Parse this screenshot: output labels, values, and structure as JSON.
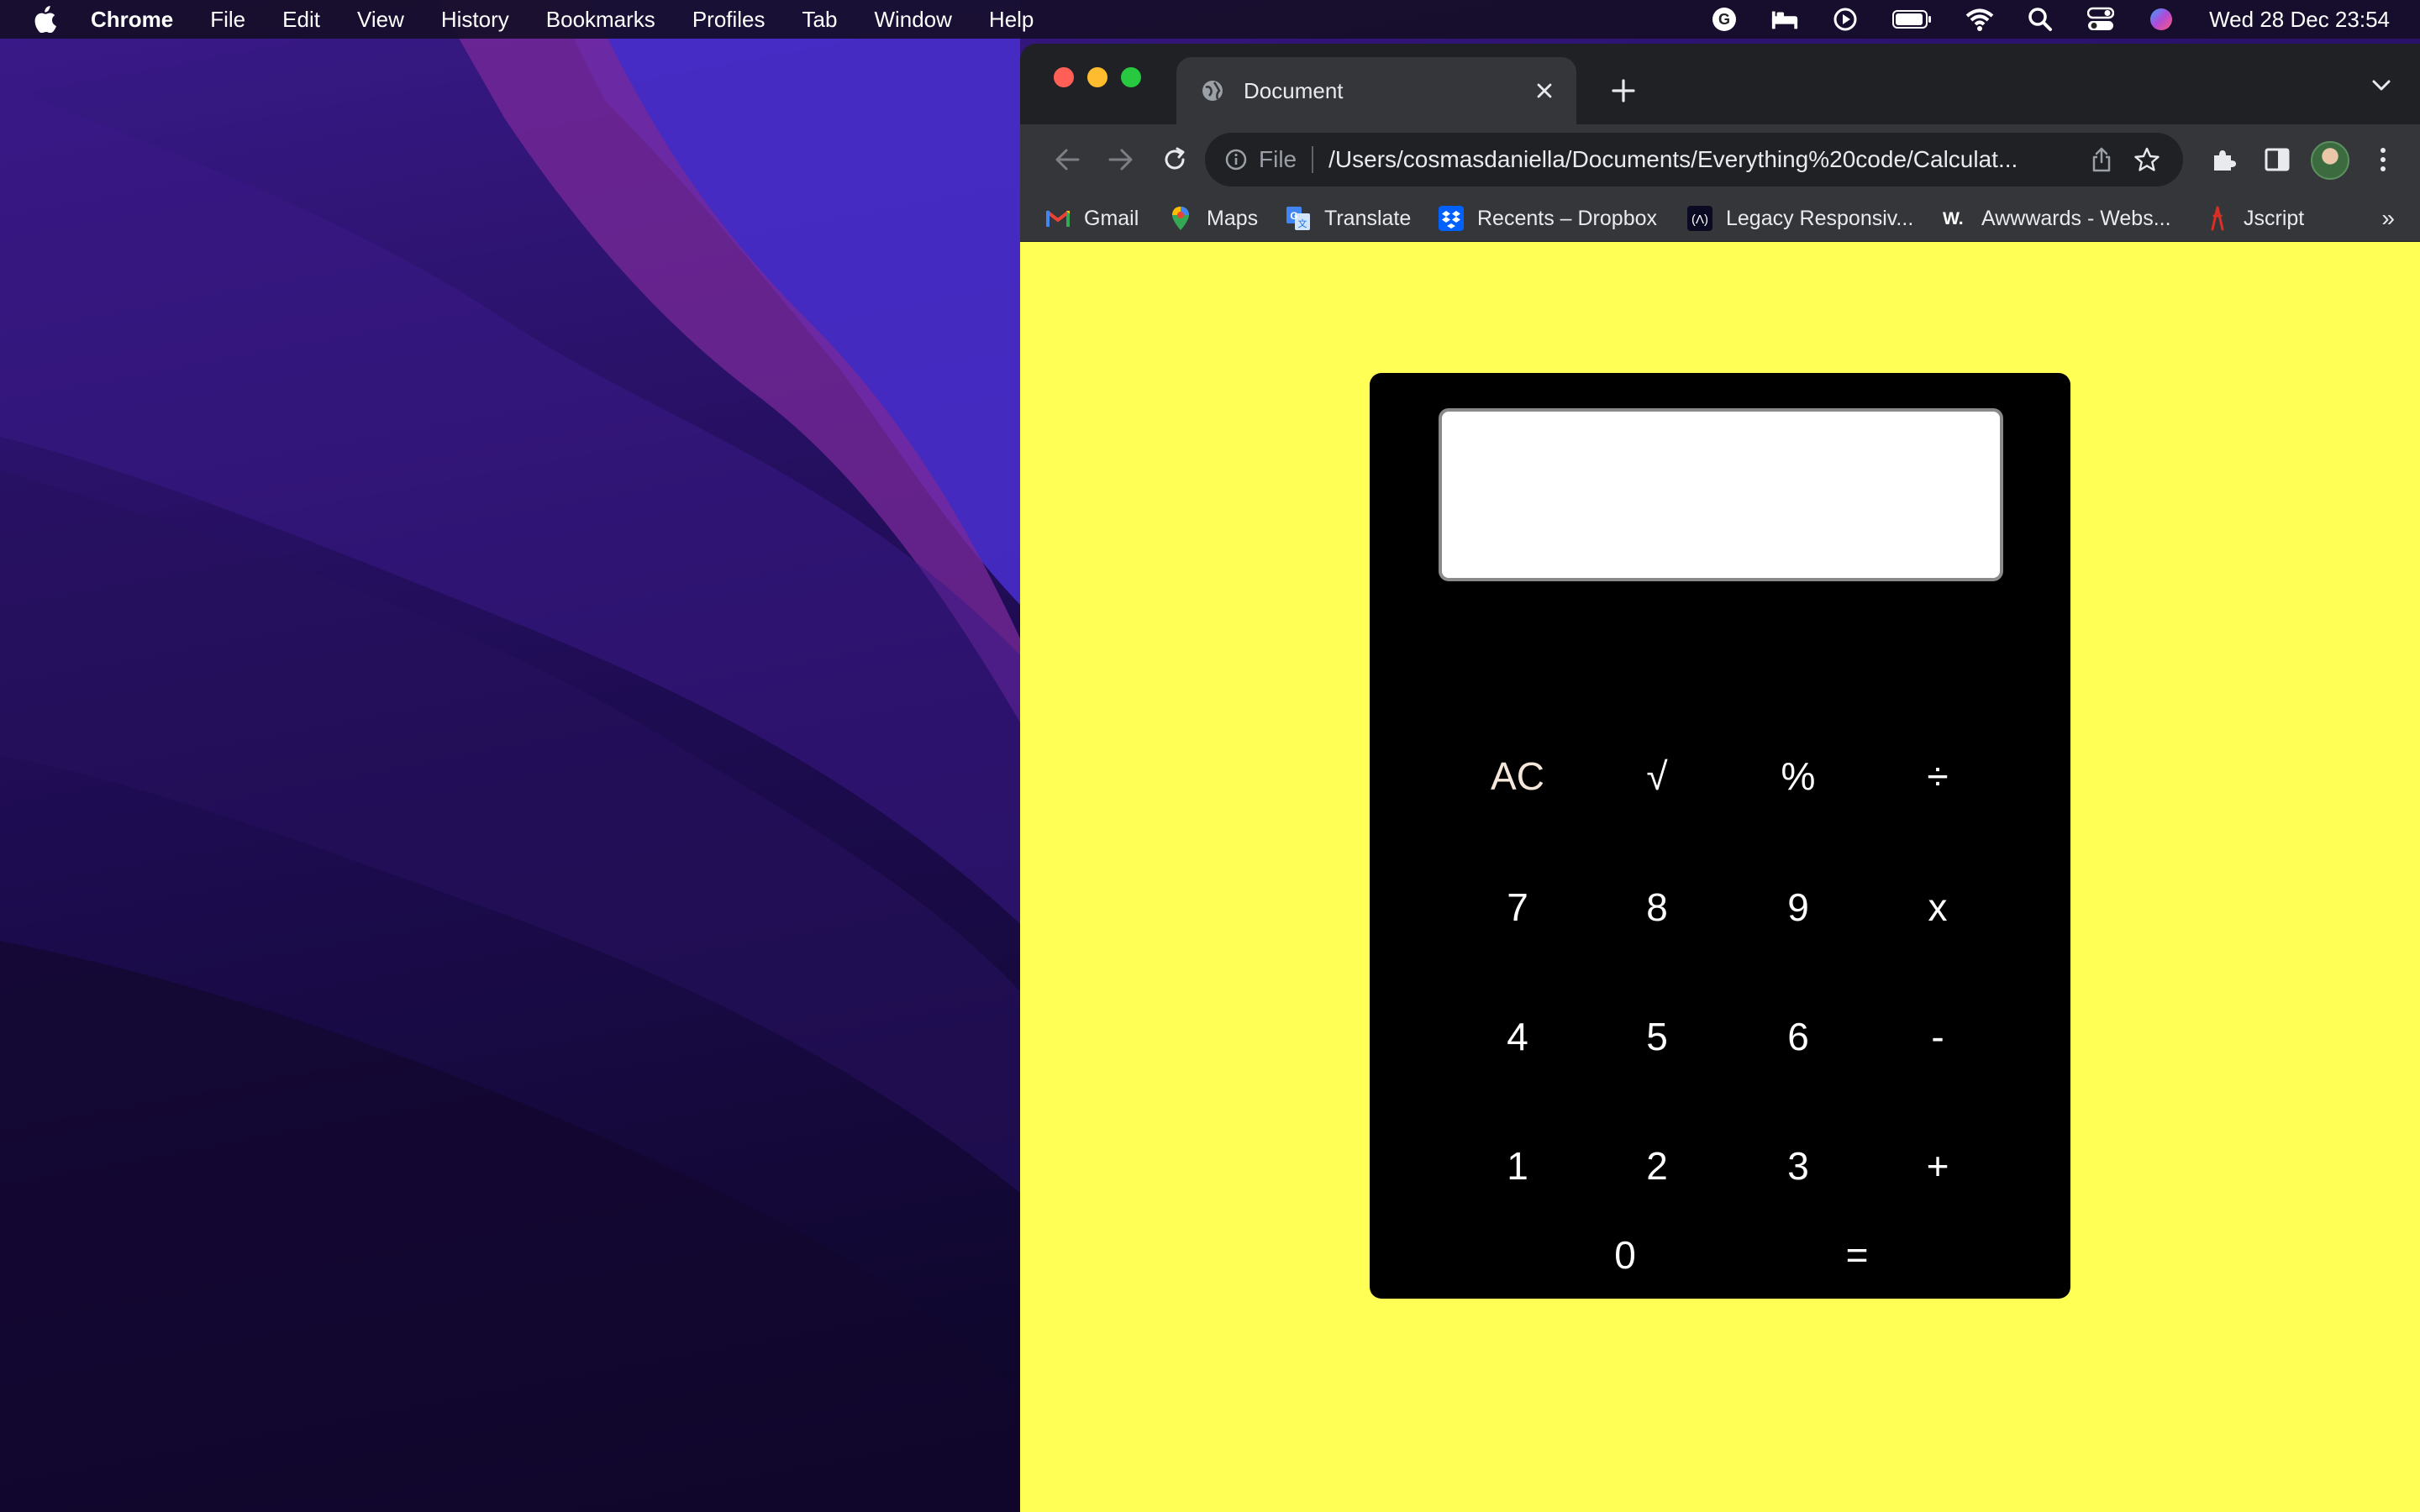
{
  "menubar": {
    "app": "Chrome",
    "items": [
      "File",
      "Edit",
      "View",
      "History",
      "Bookmarks",
      "Profiles",
      "Tab",
      "Window",
      "Help"
    ],
    "clock": "Wed 28 Dec  23:54",
    "status_icons": [
      "grammarly-icon",
      "bed-icon",
      "play-icon",
      "battery-icon",
      "wifi-icon",
      "spotlight-search-icon",
      "control-center-icon",
      "siri-icon"
    ]
  },
  "browser": {
    "tab_title": "Document",
    "scheme_label": "File",
    "url": "/Users/cosmasdaniella/Documents/Everything%20code/Calculat...",
    "bookmarks": [
      "Gmail",
      "Maps",
      "Translate",
      "Recents – Dropbox",
      "Legacy Responsiv...",
      "Awwwards - Webs...",
      "Jscript"
    ],
    "bookmarks_overflow": "»"
  },
  "page": {
    "background_color": "#ffff55",
    "calculator": {
      "display_value": "",
      "keys": [
        "AC",
        "√",
        "%",
        "÷",
        "7",
        "8",
        "9",
        "x",
        "4",
        "5",
        "6",
        "-",
        "1",
        "2",
        "3",
        "+",
        "0",
        "="
      ]
    }
  }
}
